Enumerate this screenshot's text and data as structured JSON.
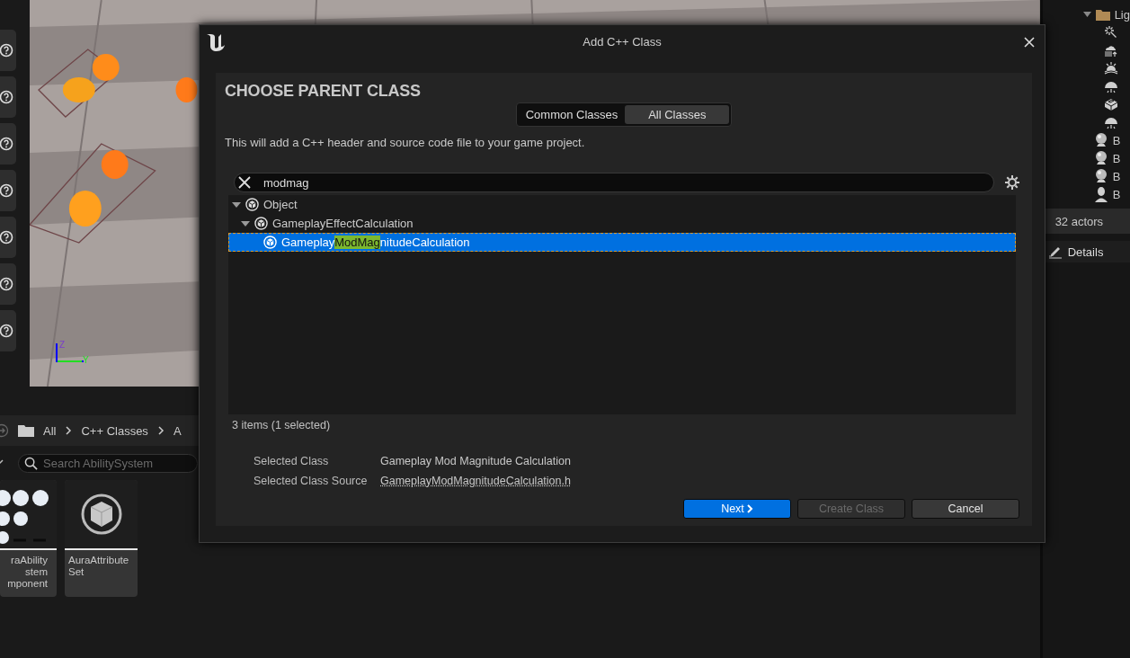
{
  "viewport": {
    "kind": "picture",
    "axes": [
      "Z",
      "Y"
    ]
  },
  "content_browser": {
    "breadcrumbs": [
      "All",
      "C++ Classes",
      "A"
    ],
    "search": {
      "placeholder": "Search AbilitySystem"
    },
    "assets": [
      {
        "kind": "dots",
        "lines": [
          "raAbility",
          "stem",
          "mponent"
        ]
      },
      {
        "kind": "class",
        "lines": [
          "AuraAttribute",
          "Set"
        ]
      }
    ]
  },
  "outliner": {
    "items": [
      {
        "kind": "folder",
        "label": "Lig",
        "expanded": true
      },
      {
        "kind": "light"
      },
      {
        "kind": "cloud"
      },
      {
        "kind": "sun"
      },
      {
        "kind": "dome"
      },
      {
        "kind": "box"
      },
      {
        "kind": "dome"
      },
      {
        "kind": "camera",
        "label": "B"
      },
      {
        "kind": "camera",
        "label": "B"
      },
      {
        "kind": "camera",
        "label": "B"
      },
      {
        "kind": "person",
        "label": "B"
      }
    ],
    "count": "32 actors",
    "details_tab": "Details"
  },
  "dialog": {
    "title": "Add C++ Class",
    "heading": "CHOOSE PARENT CLASS",
    "tabs": [
      {
        "label": "Common Classes",
        "selected": false
      },
      {
        "label": "All Classes",
        "selected": true
      }
    ],
    "description": "This will add a C++ header and source code file to your game project.",
    "search": {
      "value": "modmag"
    },
    "tree": [
      {
        "label": "Object",
        "selected": false,
        "expanded": true,
        "children": [
          {
            "label": "GameplayEffectCalculation",
            "selected": false,
            "expanded": true,
            "children": [
              {
                "label_parts": [
                  {
                    "text": "Gameplay",
                    "match": false
                  },
                  {
                    "text": "ModMag",
                    "match": true
                  },
                  {
                    "text": "nitudeCalculation",
                    "match": false
                  }
                ],
                "selected": true
              }
            ]
          }
        ]
      }
    ],
    "status": "3 items (1 selected)",
    "info": [
      {
        "label": "Selected Class",
        "value": "Gameplay Mod Magnitude Calculation",
        "kind": "text"
      },
      {
        "label": "Selected Class Source",
        "value": "GameplayModMagnitudeCalculation.h",
        "kind": "link"
      }
    ],
    "buttons": [
      {
        "label": "Next",
        "kind": "primary",
        "disabled": false
      },
      {
        "label": "Create Class",
        "kind": "normal",
        "disabled": true
      },
      {
        "label": "Cancel",
        "kind": "normal",
        "disabled": false
      }
    ]
  }
}
